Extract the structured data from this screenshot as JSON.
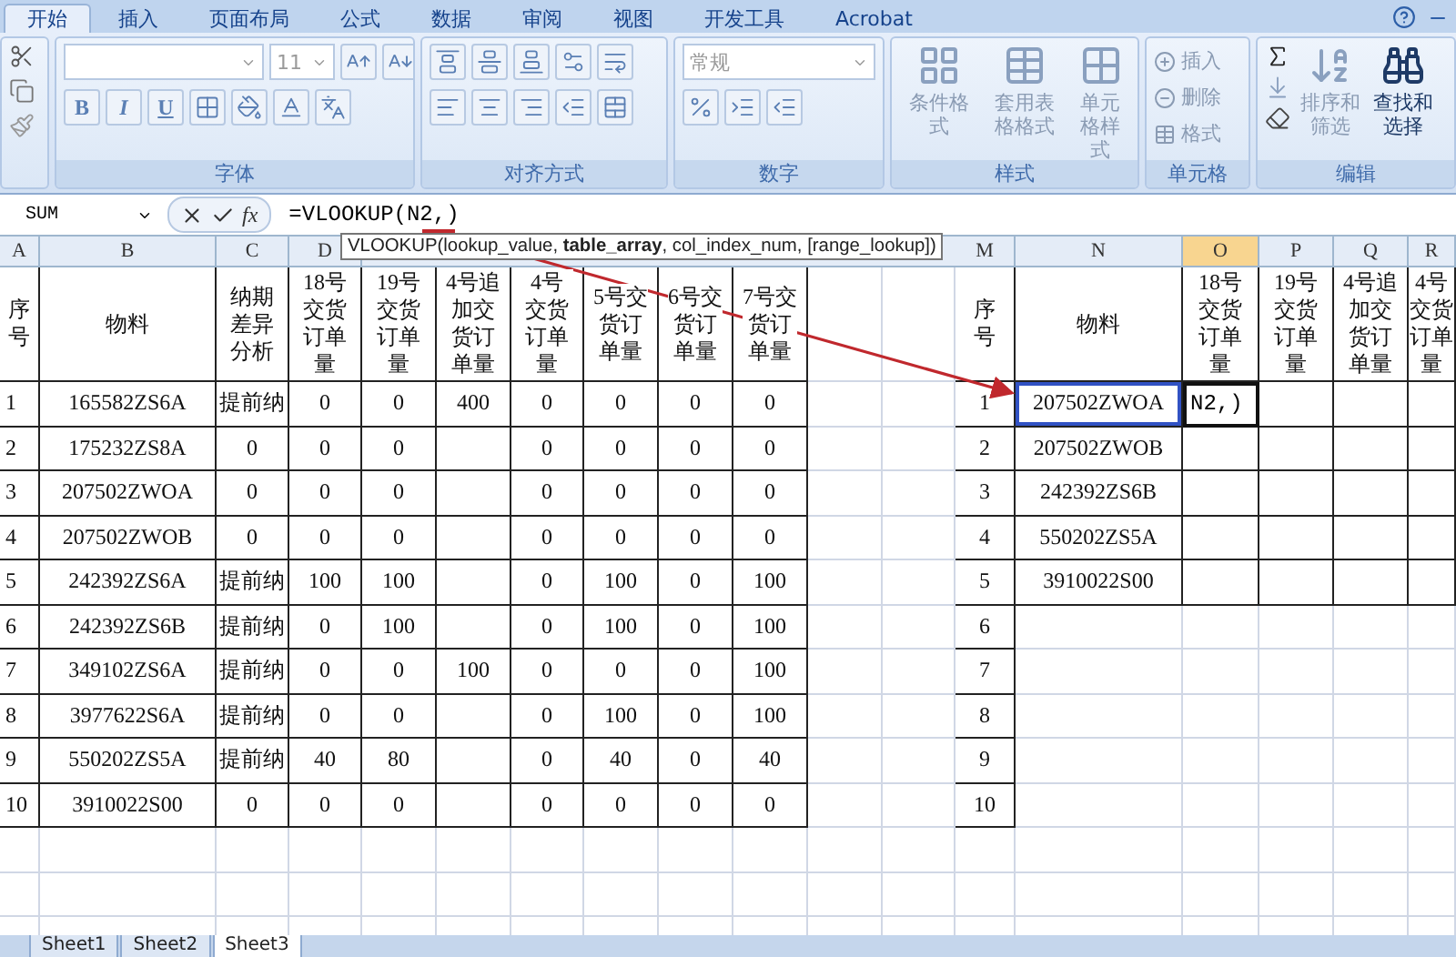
{
  "ribbon_tabs": [
    {
      "label": "开始",
      "selected": true
    },
    {
      "label": "插入",
      "selected": false
    },
    {
      "label": "页面布局",
      "selected": false
    },
    {
      "label": "公式",
      "selected": false
    },
    {
      "label": "数据",
      "selected": false
    },
    {
      "label": "审阅",
      "selected": false
    },
    {
      "label": "视图",
      "selected": false
    },
    {
      "label": "开发工具",
      "selected": false
    },
    {
      "label": "Acrobat",
      "selected": false
    }
  ],
  "font_group": {
    "font_size": "11",
    "format_buttons": [
      "B",
      "I",
      "U"
    ],
    "label": "字体"
  },
  "alignment_group": {
    "label": "对齐方式"
  },
  "number_group": {
    "format": "常规",
    "label": "数字"
  },
  "styles_group": {
    "buttons": [
      {
        "label": "条件格式",
        "disabled": true
      },
      {
        "label": "套用表格格式",
        "disabled": true
      },
      {
        "label": "单元格样式",
        "disabled": true
      }
    ],
    "label": "样式"
  },
  "cells_group": {
    "buttons": [
      {
        "label": "插入",
        "disabled": true
      },
      {
        "label": "删除",
        "disabled": true
      },
      {
        "label": "格式",
        "disabled": true
      }
    ],
    "label": "单元格"
  },
  "editing_group": {
    "buttons": [
      {
        "label": "排序和筛选",
        "disabled": true
      },
      {
        "label": "查找和选择",
        "disabled": false
      }
    ],
    "label": "编辑"
  },
  "name_box": "SUM",
  "fx_label": "fx",
  "formula": "=VLOOKUP(N2,)",
  "tooltip": "VLOOKUP(lookup_value, **table_array**, col_index_num, [range_lookup])",
  "column_headers_left": [
    {
      "label": "A",
      "selected": false
    },
    {
      "label": "B",
      "selected": false
    },
    {
      "label": "C",
      "selected": false
    },
    {
      "label": "D",
      "selected": false
    }
  ],
  "column_headers_right": [
    {
      "label": "M",
      "selected": false
    },
    {
      "label": "N",
      "selected": false
    },
    {
      "label": "O",
      "selected": true
    },
    {
      "label": "P",
      "selected": false
    },
    {
      "label": "Q",
      "selected": false
    },
    {
      "label": "R",
      "selected": false
    }
  ],
  "left_table": {
    "headers": [
      "序号",
      "物料",
      "纳期差异分析",
      "18号交货订单量",
      "19号交货订单量",
      "4号追加交货订单量",
      "4号交货订单量",
      "5号交货订单量",
      "6号交货订单量",
      "7号交货订单量"
    ],
    "rows": [
      [
        "1",
        "165582ZS6A",
        "提前纳",
        "0",
        "0",
        "400",
        "0",
        "0",
        "0",
        "0"
      ],
      [
        "2",
        "175232ZS8A",
        "0",
        "0",
        "0",
        null,
        "0",
        "0",
        "0",
        "0"
      ],
      [
        "3",
        "207502ZWOA",
        "0",
        "0",
        "0",
        null,
        "0",
        "0",
        "0",
        "0"
      ],
      [
        "4",
        "207502ZWOB",
        "0",
        "0",
        "0",
        null,
        "0",
        "0",
        "0",
        "0"
      ],
      [
        "5",
        "242392ZS6A",
        "提前纳",
        "100",
        "100",
        null,
        "0",
        "100",
        "0",
        "100"
      ],
      [
        "6",
        "242392ZS6B",
        "提前纳",
        "0",
        "100",
        null,
        "0",
        "100",
        "0",
        "100"
      ],
      [
        "7",
        "349102ZS6A",
        "提前纳",
        "0",
        "0",
        "100",
        "0",
        "0",
        "0",
        "100"
      ],
      [
        "8",
        "3977622S6A",
        "提前纳",
        "0",
        "0",
        null,
        "0",
        "100",
        "0",
        "100"
      ],
      [
        "9",
        "550202ZS5A",
        "提前纳",
        "40",
        "80",
        null,
        "0",
        "40",
        "0",
        "40"
      ],
      [
        "10",
        "3910022S00",
        "0",
        "0",
        "0",
        null,
        "0",
        "0",
        "0",
        "0"
      ]
    ]
  },
  "right_table": {
    "headers": [
      "序号",
      "物料",
      "18号交货订单量",
      "19号交货订单量",
      "4号追加交货订单量",
      "4号交货订单量"
    ],
    "rows": [
      {
        "cells": [
          "1",
          "207502ZWOA"
        ],
        "referenced": true
      },
      {
        "cells": [
          "2",
          "207502ZWOB"
        ],
        "referenced": false
      },
      {
        "cells": [
          "3",
          "242392ZS6B"
        ],
        "referenced": false
      },
      {
        "cells": [
          "4",
          "550202ZS5A"
        ],
        "referenced": false
      },
      {
        "cells": [
          "5",
          "3910022S00"
        ],
        "referenced": false
      },
      {
        "cells": [
          "6"
        ],
        "referenced": false
      },
      {
        "cells": [
          "7"
        ],
        "referenced": false
      },
      {
        "cells": [
          "8"
        ],
        "referenced": false
      },
      {
        "cells": [
          "9"
        ],
        "referenced": false
      },
      {
        "cells": [
          "10"
        ],
        "referenced": false
      }
    ]
  },
  "active_cell_text": "N2,)",
  "sheet_tabs": [
    {
      "label": "Sheet1",
      "selected": false
    },
    {
      "label": "Sheet2",
      "selected": false
    },
    {
      "label": "Sheet3",
      "selected": true
    }
  ]
}
